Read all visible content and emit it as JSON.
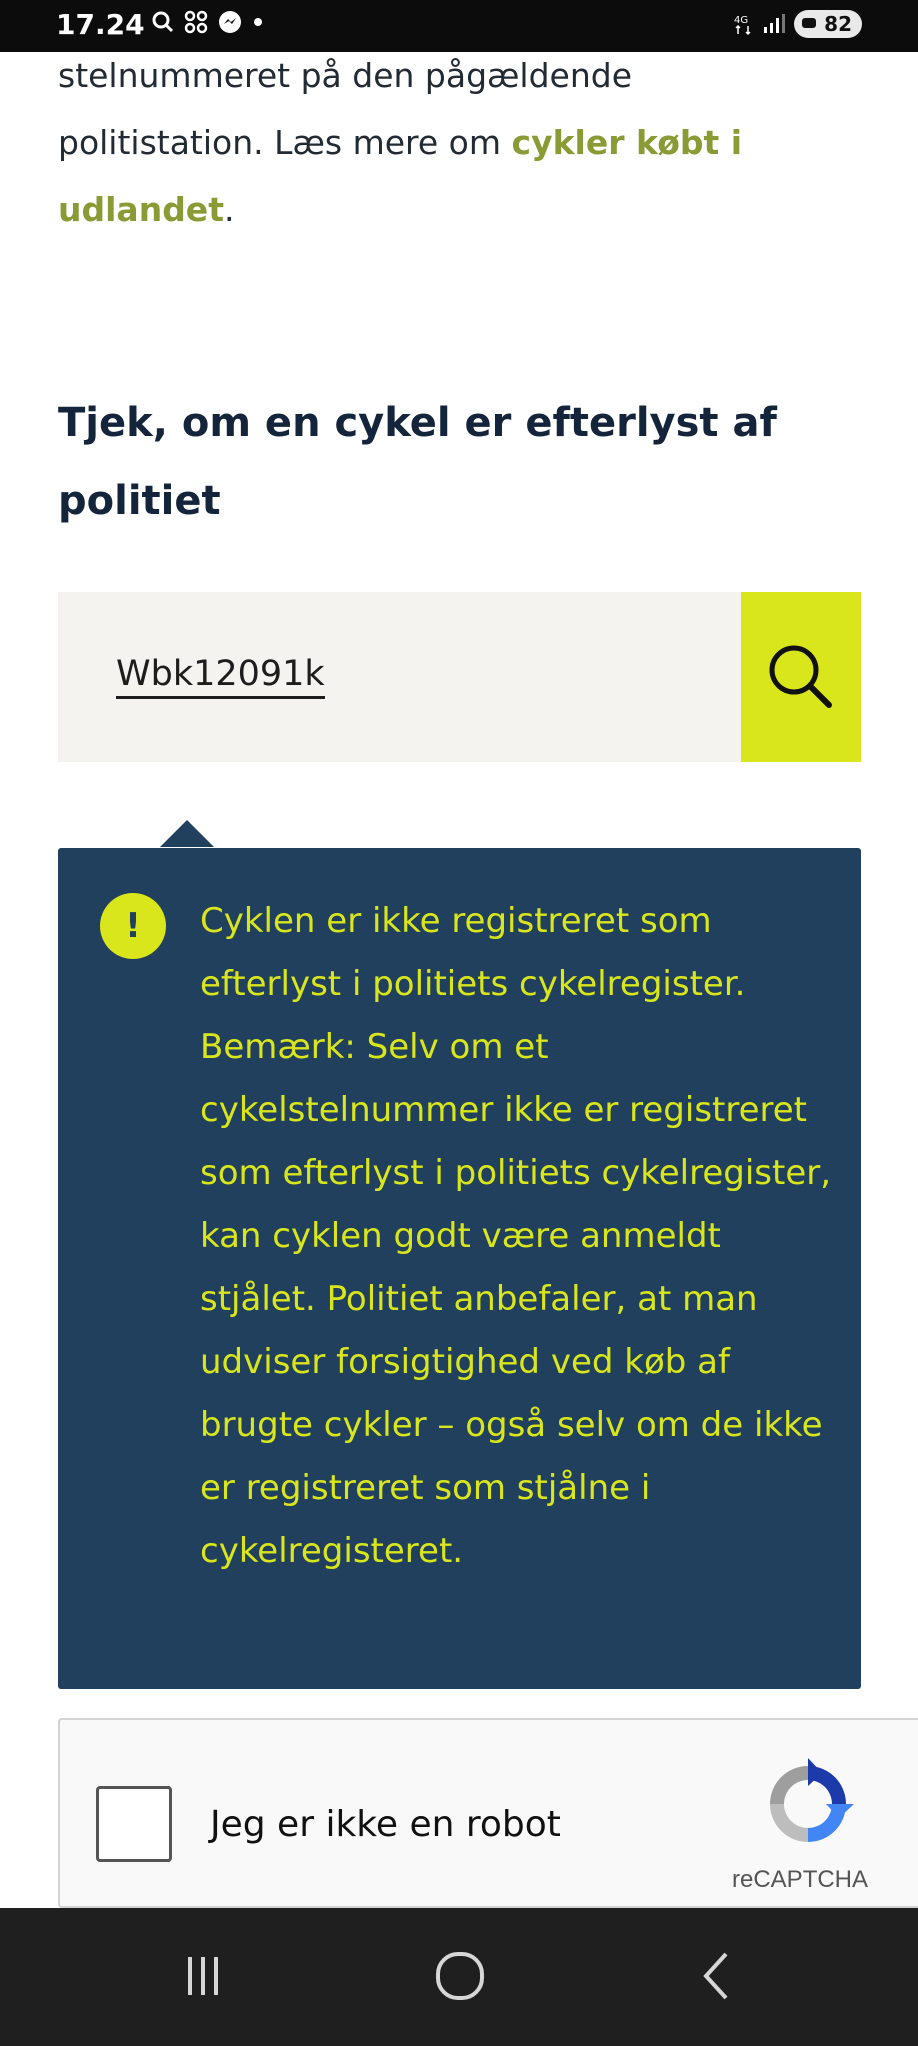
{
  "status_bar": {
    "time": "17.24",
    "battery": "82"
  },
  "intro": {
    "text_before": "stelnummeret på den pågældende politistation. Læs mere om ",
    "link_label": "cykler købt i udlandet",
    "text_after": "."
  },
  "heading": "Tjek, om en cykel er efterlyst af politiet",
  "search": {
    "value": "Wbk12091k"
  },
  "notice": {
    "icon_symbol": "!",
    "text": "Cyklen er ikke registreret som efterlyst i politiets cykelregister. Bemærk: Selv om et cykelstelnummer ikke er registreret som efterlyst i politiets cykelregister, kan cyklen godt være anmeldt stjålet. Politiet anbefaler, at man udviser forsigtighed ved køb af brugte cykler – også selv om de ikke er registreret som stjålne i cykelregisteret."
  },
  "captcha": {
    "label": "Jeg er ikke en robot",
    "brand": "reCAPTCHA"
  },
  "colors": {
    "accent": "#d9e61b",
    "notice_bg": "#20405d",
    "link": "#8a9a34"
  },
  "icons": {
    "search": "search-icon",
    "warning": "exclamation-icon",
    "recent": "recent-apps-icon",
    "home": "home-icon",
    "back": "back-icon"
  }
}
